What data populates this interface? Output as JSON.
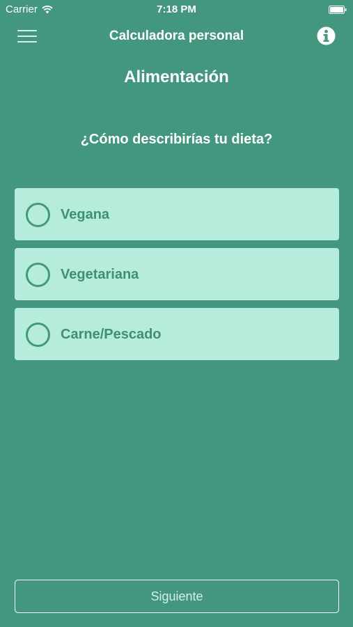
{
  "status_bar": {
    "carrier": "Carrier",
    "time": "7:18 PM"
  },
  "nav": {
    "title": "Calculadora personal",
    "menu_icon": "hamburger-menu-icon",
    "info_icon": "info-icon"
  },
  "section": {
    "title": "Alimentación",
    "question": "¿Cómo describirías tu dieta?"
  },
  "options": [
    {
      "label": "Vegana",
      "selected": false
    },
    {
      "label": "Vegetariana",
      "selected": false
    },
    {
      "label": "Carne/Pescado",
      "selected": false
    }
  ],
  "next_button": {
    "label": "Siguiente"
  },
  "colors": {
    "background": "#44977f",
    "option_background": "#b5ecdb",
    "option_text": "#3f8f76"
  }
}
